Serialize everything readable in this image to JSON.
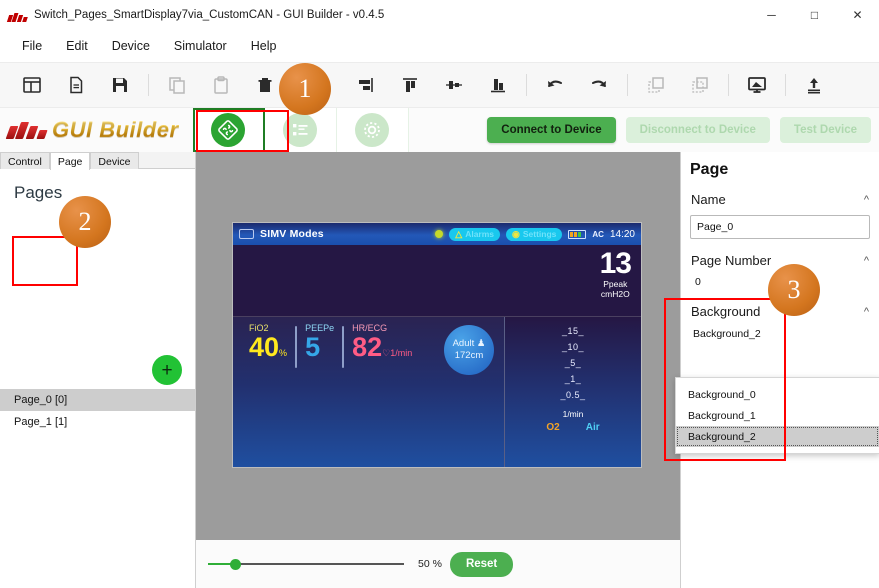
{
  "window": {
    "title": "Switch_Pages_SmartDisplay7via_CustomCAN - GUI Builder - v0.4.5",
    "minimize": "─",
    "maximize": "□",
    "close": "✕"
  },
  "menu": {
    "items": [
      "File",
      "Edit",
      "Device",
      "Simulator",
      "Help"
    ]
  },
  "toolbar": {
    "icons": [
      "new-layout-icon",
      "new-file-icon",
      "save-icon",
      "copy-icon",
      "paste-icon",
      "delete-icon",
      "align-center-vertical-icon",
      "align-right-icon",
      "align-top-icon",
      "distribute-horizontal-icon",
      "align-bottom-icon",
      "undo-icon",
      "redo-icon",
      "bring-front-icon",
      "send-back-icon",
      "preview-icon",
      "export-icon"
    ]
  },
  "brand": {
    "name": "GUI Builder",
    "mode_buttons": [
      {
        "name": "design-mode-button",
        "icon": "puzzle-icon",
        "state": "active"
      },
      {
        "name": "list-mode-button",
        "icon": "list-icon",
        "state": "disabled"
      },
      {
        "name": "settings-mode-button",
        "icon": "gear-icon",
        "state": "disabled"
      }
    ],
    "connect_label": "Connect to Device",
    "disconnect_label": "Disconnect to Device",
    "test_label": "Test Device"
  },
  "left_panel": {
    "tabs": [
      {
        "label": "Control",
        "active": false
      },
      {
        "label": "Page",
        "active": true
      },
      {
        "label": "Device",
        "active": false
      }
    ],
    "heading": "Pages",
    "add_label": "+",
    "pages": [
      {
        "label": "Page_0 [0]",
        "selected": true
      },
      {
        "label": "Page_1 [1]",
        "selected": false
      }
    ]
  },
  "canvas": {
    "zoom_value": "50 %",
    "zoom_percent": 50,
    "reset_label": "Reset"
  },
  "device_screen": {
    "topbar": {
      "title": "SIMV Modes",
      "alarms_label": "Alarms",
      "settings_label": "Settings",
      "ac_label": "AC",
      "time": "14:20"
    },
    "ppeak": {
      "value": "13",
      "label": "Ppeak",
      "unit": "cmH2O"
    },
    "vitals": [
      {
        "label": "FiO2",
        "value": "40",
        "unit": "%",
        "key": "fio2"
      },
      {
        "label": "PEEPe",
        "value": "5",
        "unit": "",
        "key": "peep"
      },
      {
        "label": "HR/ECG",
        "value": "82",
        "unit": "1/min",
        "key": "hr"
      }
    ],
    "patient_badge": {
      "line1": "Adult",
      "line2": "172cm",
      "icon": "person-icon"
    },
    "scale": {
      "ticks": [
        "_15_",
        "_10_",
        "_5_",
        "_1_",
        "_0.5_"
      ],
      "unit": "1/min",
      "gas_left": "O2",
      "gas_right": "Air"
    }
  },
  "right_panel": {
    "title": "Page",
    "name_section": {
      "label": "Name",
      "value": "Page_0"
    },
    "page_number_section": {
      "label": "Page Number",
      "value": "0"
    },
    "background_section": {
      "label": "Background",
      "value": "Background_2"
    },
    "dropdown_options": [
      {
        "label": "Background_0",
        "selected": false
      },
      {
        "label": "Background_1",
        "selected": false
      },
      {
        "label": "Background_2",
        "selected": true
      }
    ],
    "collapse_icon": "⌃"
  },
  "annotations": {
    "badges": [
      {
        "number": "1"
      },
      {
        "number": "2"
      },
      {
        "number": "3"
      }
    ],
    "color": "#ff0000"
  }
}
